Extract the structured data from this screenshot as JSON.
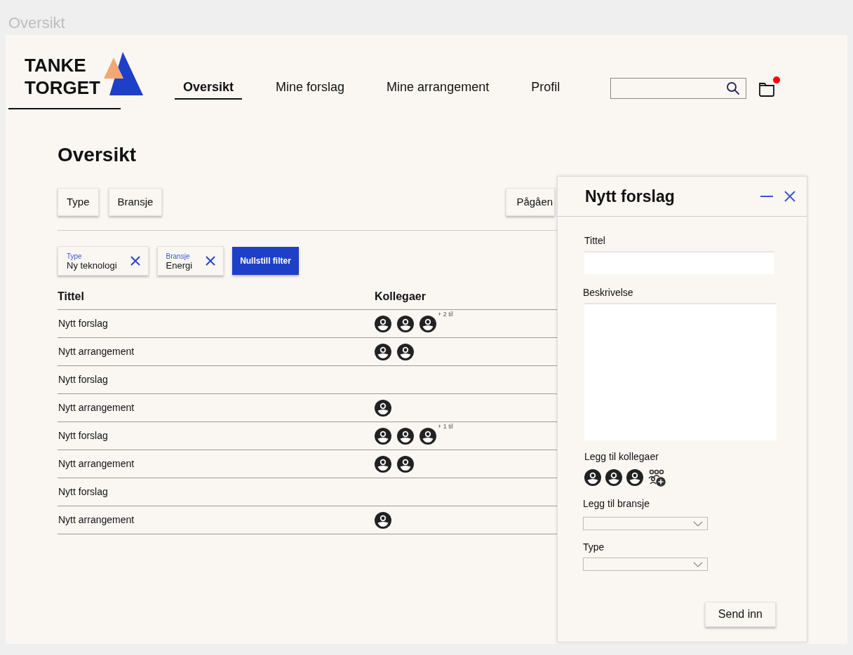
{
  "frame_title": "Oversikt",
  "logo": {
    "line1": "TANKE",
    "line2": "TORGET"
  },
  "nav": [
    {
      "label": "Oversikt",
      "selected": true
    },
    {
      "label": "Mine forslag",
      "selected": false
    },
    {
      "label": "Mine arrangement",
      "selected": false
    },
    {
      "label": "Profil",
      "selected": false
    }
  ],
  "notification": true,
  "page_title": "Oversikt",
  "filter_buttons": [
    "Type",
    "Bransje"
  ],
  "status_button": "Pågåen",
  "active_filters": [
    {
      "label": "Type",
      "value": "Ny teknologi"
    },
    {
      "label": "Bransje",
      "value": "Energi"
    }
  ],
  "reset_button": "Nullstill filter",
  "table": {
    "columns": [
      "Tittel",
      "Kollegaer"
    ],
    "rows": [
      {
        "title": "Nytt forslag",
        "colleagues": [
          {
            "kind": "avatar"
          },
          {
            "kind": "avatar"
          },
          {
            "kind": "avatar"
          }
        ],
        "more": "+ 2 til"
      },
      {
        "title": "Nytt arrangement",
        "colleagues": [
          {
            "kind": "avatar"
          },
          {
            "kind": "avatar"
          }
        ]
      },
      {
        "title": "Nytt forslag"
      },
      {
        "title": "Nytt arrangement",
        "colleagues": [
          {
            "kind": "avatar"
          }
        ]
      },
      {
        "title": "Nytt forslag",
        "colleagues": [
          {
            "kind": "avatar"
          },
          {
            "kind": "avatar"
          },
          {
            "kind": "avatar"
          }
        ],
        "more": "+ 1 til"
      },
      {
        "title": "Nytt arrangement",
        "colleagues": [
          {
            "kind": "avatar"
          },
          {
            "kind": "avatar"
          }
        ]
      },
      {
        "title": "Nytt forslag"
      },
      {
        "title": "Nytt arrangement",
        "colleagues": [
          {
            "kind": "avatar"
          }
        ]
      }
    ]
  },
  "panel": {
    "title": "Nytt forslag",
    "title_label": "Tittel",
    "description_label": "Beskrivelse",
    "colleagues_label": "Legg til kollegaer",
    "colleagues": [
      {
        "kind": "avatar"
      },
      {
        "kind": "avatar"
      },
      {
        "kind": "avatar"
      },
      {
        "kind": "add"
      }
    ],
    "industry_label": "Legg til bransje",
    "type_label": "Type",
    "submit": "Send inn"
  }
}
